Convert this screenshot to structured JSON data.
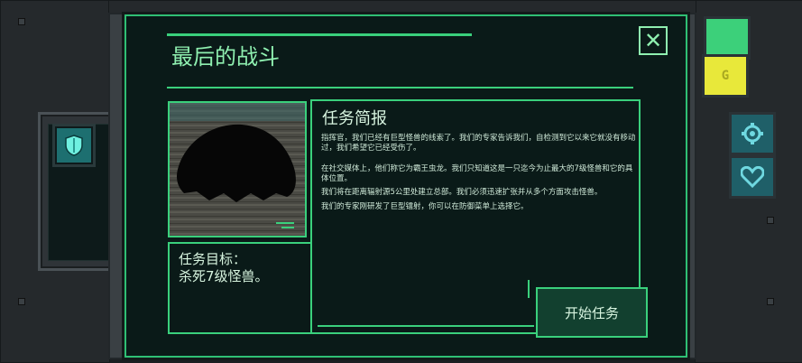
{
  "dialog": {
    "title": "最后的战斗",
    "close_label": "✕",
    "goal": {
      "text": "任务目标：\n杀死7级怪兽。"
    },
    "briefing": {
      "title": "任务简报",
      "paragraphs": [
        "指挥官，我们已经有巨型怪兽的线索了。我们的专家告诉我们，自检测到它以来它就没有移动过，我们希望它已经受伤了。",
        "在社交媒体上，他们称它为霸王虫龙。我们只知道这是一只迄今为止最大的7级怪兽和它的具体位置。",
        "我们将在距离辐射源5公里处建立总部。我们必须迅速扩张并从多个方面攻击怪兽。",
        "我们的专家刚研发了巨型镭射，你可以在防御菜单上选择它。"
      ]
    },
    "start_button": "开始任务"
  },
  "side_buttons": {
    "left": "shield-icon",
    "right_top_green": "green-button",
    "right_yellow": "gold-coin-icon",
    "right_settings": "gear-icon",
    "right_health": "heart-icon"
  },
  "colors": {
    "accent": "#3ad07c",
    "text": "#d8f5e0",
    "panel_bg": "#0a1a18"
  }
}
